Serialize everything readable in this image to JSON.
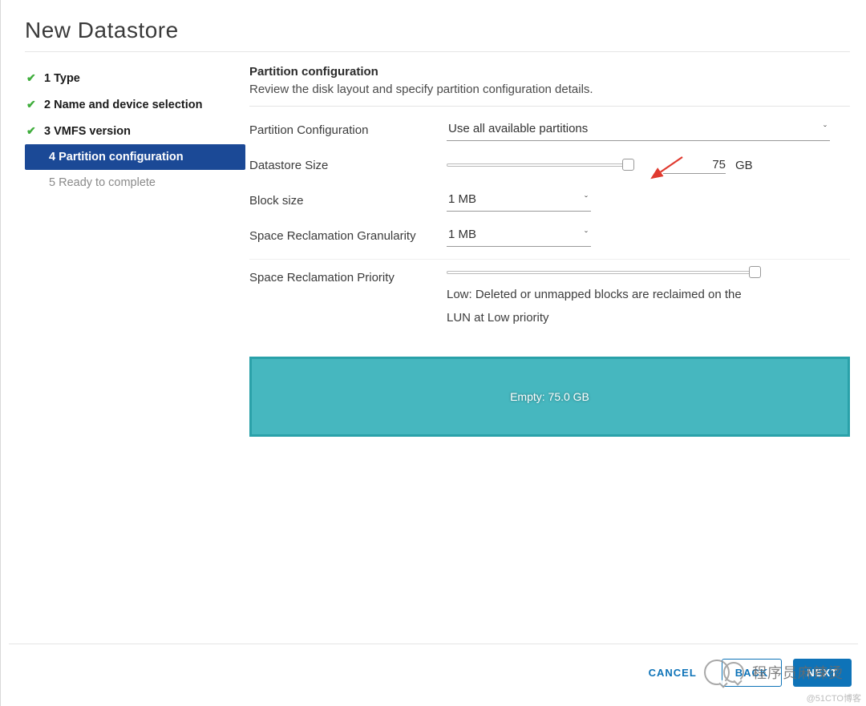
{
  "title": "New Datastore",
  "steps": {
    "s1": "1 Type",
    "s2": "2 Name and device selection",
    "s3": "3 VMFS version",
    "s4": "4 Partition configuration",
    "s5": "5 Ready to complete"
  },
  "heading": "Partition configuration",
  "description": "Review the disk layout and specify partition configuration details.",
  "labels": {
    "partition_config": "Partition Configuration",
    "datastore_size": "Datastore Size",
    "block_size": "Block size",
    "space_gran": "Space Reclamation Granularity",
    "space_pri": "Space Reclamation Priority"
  },
  "values": {
    "partition_config": "Use all available partitions",
    "datastore_size": "75",
    "datastore_unit": "GB",
    "block_size": "1 MB",
    "space_gran": "1 MB",
    "space_pri_desc": "Low: Deleted or unmapped blocks are reclaimed on the LUN at Low priority"
  },
  "disk_layout": "Empty: 75.0 GB",
  "buttons": {
    "cancel": "CANCEL",
    "back": "BACK",
    "next": "NEXT"
  },
  "watermark": {
    "text": "程序员麻辣烫",
    "small": "@51CTO博客"
  }
}
